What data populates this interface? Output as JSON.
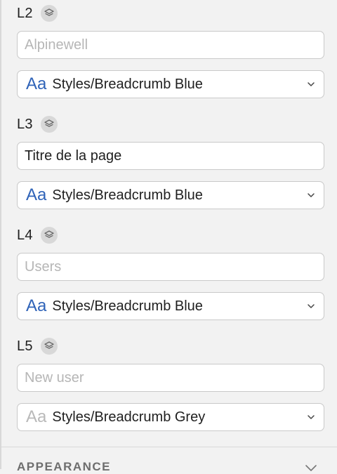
{
  "colors": {
    "aa_active": "#2f63b8",
    "aa_muted": "#b9b9b9",
    "placeholder": "#b6b6b6"
  },
  "levels": [
    {
      "label": "L2",
      "input_value": "",
      "input_placeholder": "Alpinewell",
      "style_glyph": "Aa",
      "style_value": "Styles/Breadcrumb Blue",
      "icon": "layers-icon"
    },
    {
      "label": "L3",
      "input_value": "Titre de la page",
      "input_placeholder": "",
      "style_glyph": "Aa",
      "style_value": "Styles/Breadcrumb Blue",
      "icon": "layers-icon"
    },
    {
      "label": "L4",
      "input_value": "",
      "input_placeholder": "Users",
      "style_glyph": "Aa",
      "style_value": "Styles/Breadcrumb Blue",
      "icon": "layers-icon"
    },
    {
      "label": "L5",
      "input_value": "",
      "input_placeholder": "New user",
      "style_glyph": "Aa",
      "style_value": "Styles/Breadcrumb Grey",
      "icon": "layers-icon"
    }
  ],
  "section": {
    "title": "APPEARANCE",
    "icon": "chevron-down-icon"
  }
}
